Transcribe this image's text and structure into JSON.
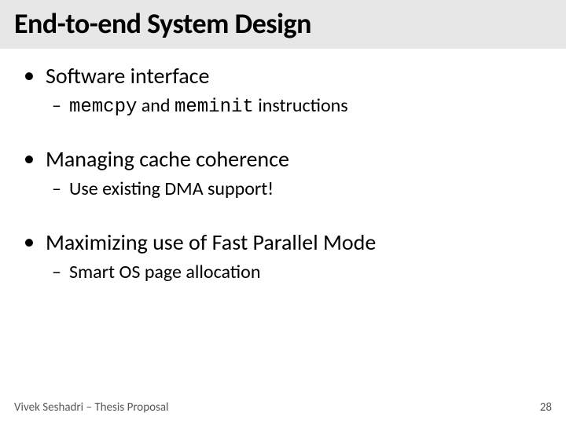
{
  "title": "End-to-end System Design",
  "bullets": [
    {
      "text": "Software interface",
      "sub_prefix": "",
      "sub_code1": "memcpy",
      "sub_mid": " and ",
      "sub_code2": "meminit",
      "sub_suffix": " instructions"
    },
    {
      "text": "Managing cache coherence",
      "sub_prefix": "Use existing DMA support!",
      "sub_code1": "",
      "sub_mid": "",
      "sub_code2": "",
      "sub_suffix": ""
    },
    {
      "text": "Maximizing use of Fast Parallel Mode",
      "sub_prefix": "Smart OS page allocation",
      "sub_code1": "",
      "sub_mid": "",
      "sub_code2": "",
      "sub_suffix": ""
    }
  ],
  "footer": {
    "author": "Vivek Seshadri – Thesis Proposal",
    "page": "28"
  }
}
